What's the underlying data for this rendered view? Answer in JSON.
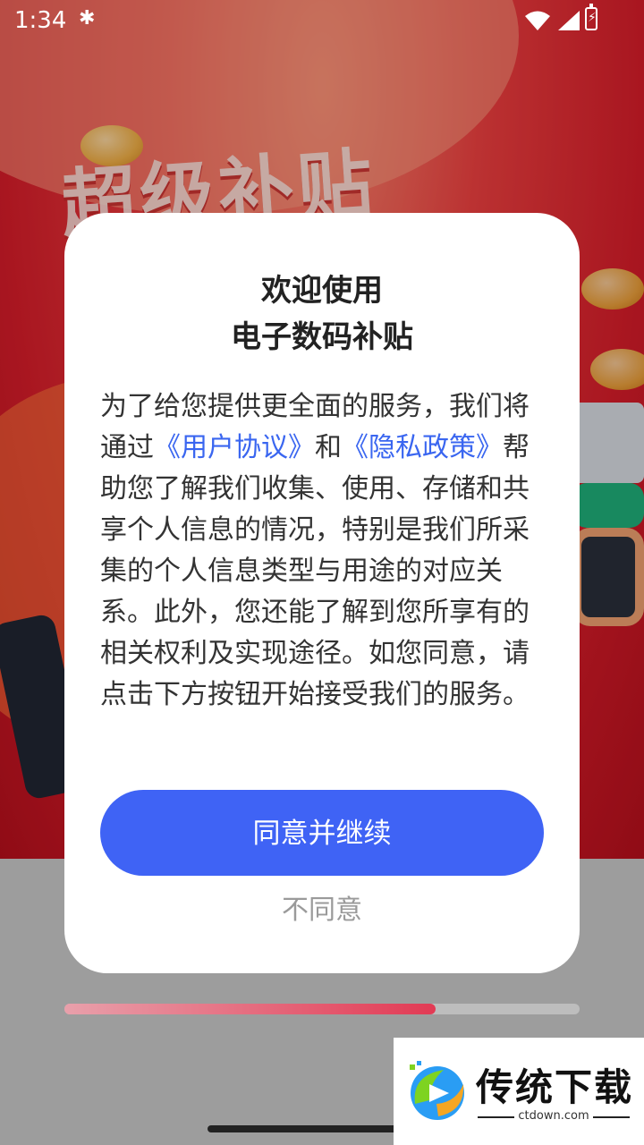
{
  "status_bar": {
    "time": "1:34",
    "bluetooth_icon": "bluetooth-icon",
    "wifi_icon": "wifi-icon",
    "signal_icon": "signal-icon",
    "battery_icon": "battery-charging-icon"
  },
  "background": {
    "banner_text": "超级补贴"
  },
  "dialog": {
    "title_line1": "欢迎使用",
    "title_line2": "电子数码补贴",
    "body_parts": {
      "p1": "为了给您提供更全面的服务，我们将通过",
      "link_user_agreement": "《用户协议》",
      "p2": "和",
      "link_privacy_policy": "《隐私政策》",
      "p3": "帮助您了解我们收集、使用、存储和共享个人信息的情况，特别是我们所采集的个人信息类型与用途的对应关系。此外，您还能了解到您所享有的相关权利及实现途径。如您同意，请点击下方按钮开始接受我们的服务。"
    },
    "agree_button": "同意并继续",
    "disagree_button": "不同意"
  },
  "progress": {
    "fraction": 0.72
  },
  "watermark": {
    "title": "传统下载",
    "subtitle": "ctdown.com"
  },
  "colors": {
    "accent": "#3f63f5",
    "link": "#3a66f0",
    "progress": "#e23a54"
  }
}
